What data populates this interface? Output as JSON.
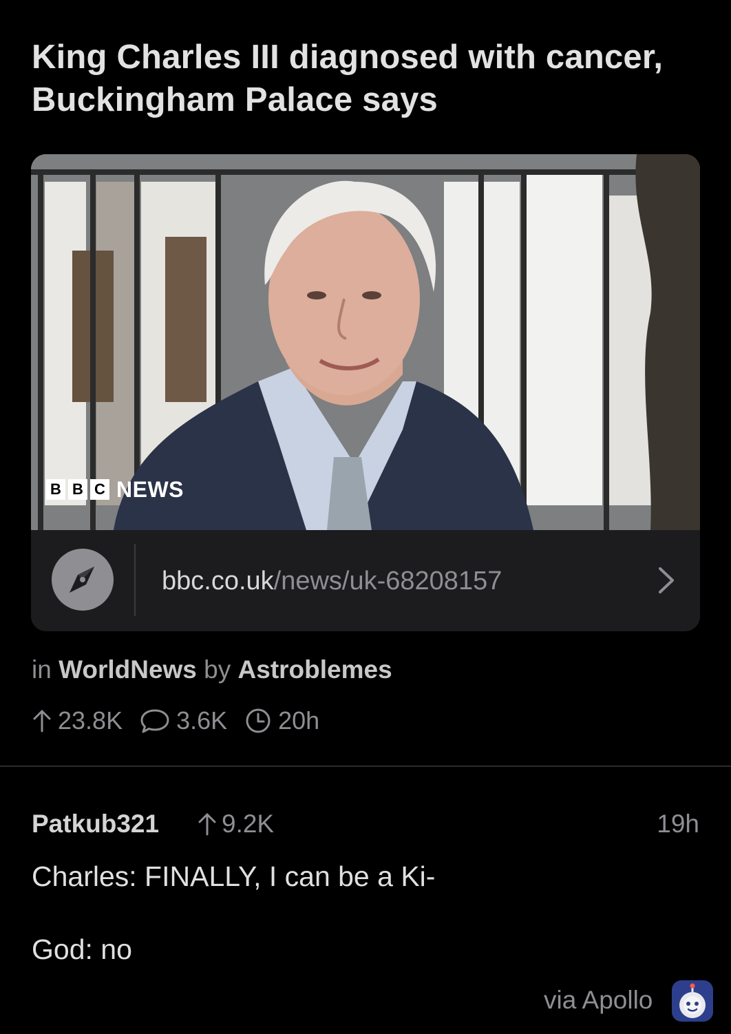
{
  "post": {
    "title": "King Charles III diagnosed with cancer, Buckingham Palace says",
    "image": {
      "watermark_boxes": [
        "B",
        "B",
        "C"
      ],
      "watermark_text": "NEWS"
    },
    "link": {
      "host": "bbc.co.uk",
      "path": "/news/uk-68208157",
      "icon": "compass-icon",
      "chevron_icon": "chevron-right-icon"
    },
    "meta": {
      "prefix": "in",
      "subreddit": "WorldNews",
      "by": "by",
      "author": "Astroblemes"
    },
    "stats": {
      "upvotes": "23.8K",
      "comments": "3.6K",
      "age": "20h"
    }
  },
  "comment": {
    "author": "Patkub321",
    "score": "9.2K",
    "age": "19h",
    "line1": "Charles: FINALLY, I can be a Ki-",
    "line2": "God: no"
  },
  "footer": {
    "via": "via Apollo",
    "icon": "apollo-app-icon"
  },
  "colors": {
    "background": "#000000",
    "card": "#1c1c1e",
    "secondary_text": "#8e8e93"
  }
}
